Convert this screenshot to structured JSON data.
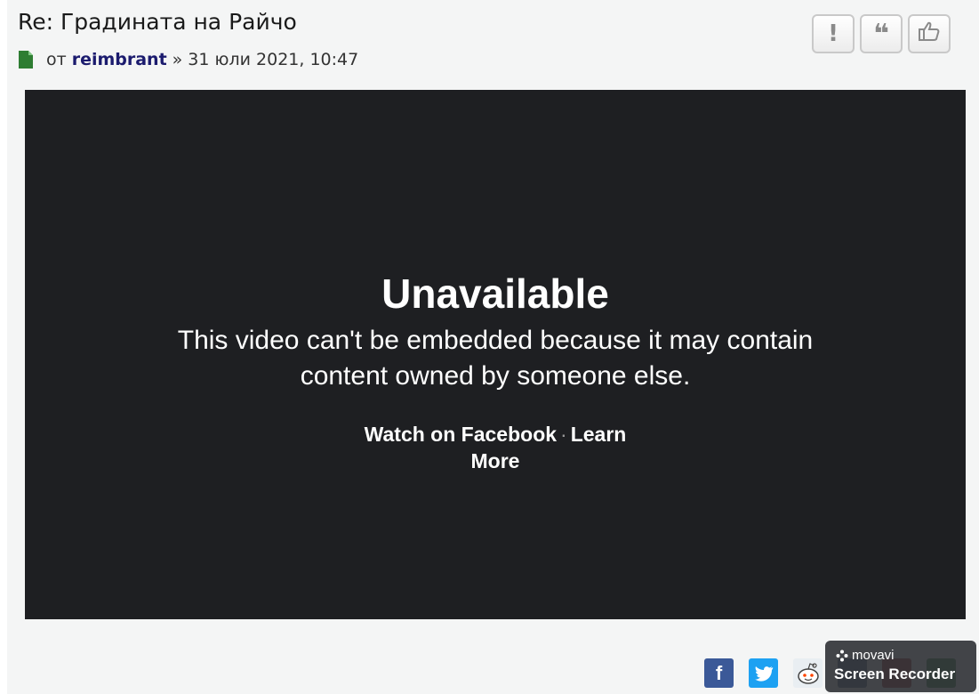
{
  "post": {
    "title": "Re: Градината на Райчо",
    "byline_prefix": "от",
    "author": "reimbrant",
    "separator": "»",
    "timestamp": "31 юли 2021, 10:47"
  },
  "actions": {
    "report_label": "!",
    "quote_label": "❝",
    "like_label": "👍"
  },
  "video": {
    "title": "Unavailable",
    "message": "This video can't be embedded because it may contain content owned by someone else.",
    "watch_link": "Watch on Facebook",
    "dot": "·",
    "learn_more_link": "Learn More"
  },
  "share": {
    "facebook": "f",
    "twitter": "t",
    "reddit": "r"
  },
  "watermark": {
    "brand": "movavi",
    "product": "Screen Recorder"
  },
  "colors": {
    "post_background": "#f4f5f5",
    "video_background": "#1e1f22",
    "author": "#1b1b6e",
    "file_icon": "#2e7d32",
    "facebook": "#3b5998",
    "twitter": "#1da1f2"
  }
}
